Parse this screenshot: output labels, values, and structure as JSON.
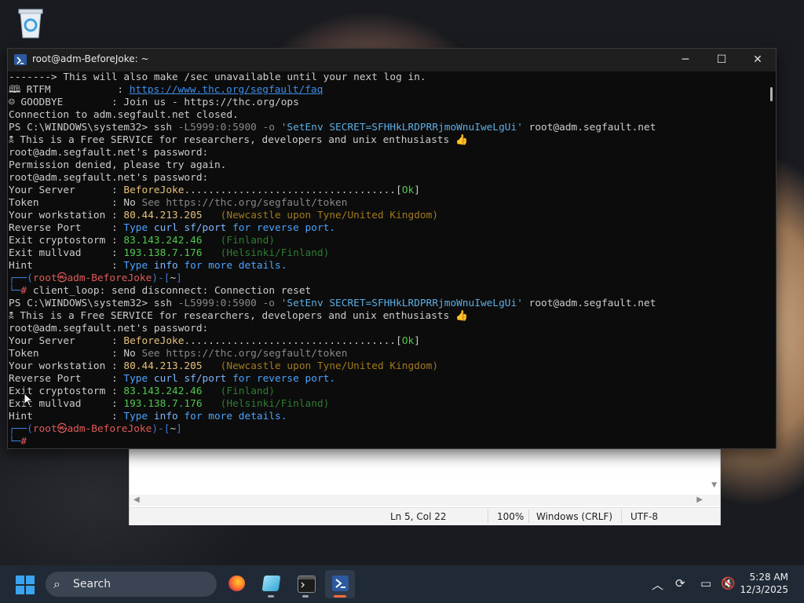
{
  "window": {
    "title": "root@adm-BeforeJoke: ~",
    "minimize": "─",
    "maximize": "☐",
    "close": "✕"
  },
  "terminal": {
    "lines": [
      [
        {
          "t": "-------> This will also make /sec unavailable until your next log in.",
          "c": "c-w"
        }
      ],
      [
        {
          "t": "🕮 RTFM           : ",
          "c": "c-w"
        },
        {
          "t": "https://www.thc.org/segfault/faq",
          "c": "c-url"
        }
      ],
      [
        {
          "t": "☺ GOODBYE        : Join us - https://thc.org/ops",
          "c": "c-w"
        }
      ],
      [
        {
          "t": "Connection to adm.segfault.net closed.",
          "c": "c-w"
        }
      ],
      [
        {
          "t": "PS C:\\WINDOWS\\system32> ssh ",
          "c": "c-w"
        },
        {
          "t": "-L5999:0:5900 -o ",
          "c": "c-gr"
        },
        {
          "t": "'SetEnv SECRET=SFHHkLRDPRRjmoWnuIweLgUi'",
          "c": "c-str"
        },
        {
          "t": " root@adm.segfault.net",
          "c": "c-w"
        }
      ],
      [
        {
          "t": "🕱 This is a Free SERVICE for researchers, developers and unix enthusiasts 👍",
          "c": "c-w"
        }
      ],
      [
        {
          "t": "root@adm.segfault.net's password:",
          "c": "c-w"
        }
      ],
      [
        {
          "t": "Permission denied, please try again.",
          "c": "c-w"
        }
      ],
      [
        {
          "t": "root@adm.segfault.net's password:",
          "c": "c-w"
        }
      ],
      [
        {
          "t": "Your Server      : ",
          "c": "c-w"
        },
        {
          "t": "BeforeJoke",
          "c": "c-y"
        },
        {
          "t": "...................................",
          "c": "c-w"
        },
        {
          "t": "[",
          "c": "c-w"
        },
        {
          "t": "Ok",
          "c": "c-g"
        },
        {
          "t": "]",
          "c": "c-w"
        }
      ],
      [
        {
          "t": "Token            : No ",
          "c": "c-w"
        },
        {
          "t": "See https://thc.org/segfault/token",
          "c": "c-gr"
        }
      ],
      [
        {
          "t": "Your workstation : ",
          "c": "c-w"
        },
        {
          "t": "80.44.213.205   ",
          "c": "c-y"
        },
        {
          "t": "(Newcastle upon Tyne/United Kingdom)",
          "c": "c-dy"
        }
      ],
      [
        {
          "t": "Reverse Port     : ",
          "c": "c-w"
        },
        {
          "t": "Type ",
          "c": "c-b"
        },
        {
          "t": "curl sf/port",
          "c": "c-bl"
        },
        {
          "t": " for reverse port.",
          "c": "c-b"
        }
      ],
      [
        {
          "t": "Exit cryptostorm : ",
          "c": "c-w"
        },
        {
          "t": "83.143.242.46   ",
          "c": "c-g"
        },
        {
          "t": "(Finland)",
          "c": "c-dg"
        }
      ],
      [
        {
          "t": "Exit mullvad     : ",
          "c": "c-w"
        },
        {
          "t": "193.138.7.176   ",
          "c": "c-g"
        },
        {
          "t": "(Helsinki/Finland)",
          "c": "c-dg"
        }
      ],
      [
        {
          "t": "Hint             : ",
          "c": "c-w"
        },
        {
          "t": "Type ",
          "c": "c-b"
        },
        {
          "t": "info",
          "c": "c-bl"
        },
        {
          "t": " for more details.",
          "c": "c-b"
        }
      ],
      [
        {
          "t": "┌──(",
          "c": "c-blue"
        },
        {
          "t": "root㉿adm-BeforeJoke",
          "c": "c-red"
        },
        {
          "t": ")-[",
          "c": "c-blue"
        },
        {
          "t": "~",
          "c": "c-w"
        },
        {
          "t": "]",
          "c": "c-blue"
        }
      ],
      [
        {
          "t": "└─",
          "c": "c-blue"
        },
        {
          "t": "# ",
          "c": "c-red"
        },
        {
          "t": "client_loop: send disconnect: Connection reset",
          "c": "c-w"
        }
      ],
      [
        {
          "t": "PS C:\\WINDOWS\\system32> ssh ",
          "c": "c-w"
        },
        {
          "t": "-L5999:0:5900 -o ",
          "c": "c-gr"
        },
        {
          "t": "'SetEnv SECRET=SFHHkLRDPRRjmoWnuIweLgUi'",
          "c": "c-str"
        },
        {
          "t": " root@adm.segfault.net",
          "c": "c-w"
        }
      ],
      [
        {
          "t": "🕱 This is a Free SERVICE for researchers, developers and unix enthusiasts 👍",
          "c": "c-w"
        }
      ],
      [
        {
          "t": "root@adm.segfault.net's password:",
          "c": "c-w"
        }
      ],
      [
        {
          "t": "Your Server      : ",
          "c": "c-w"
        },
        {
          "t": "BeforeJoke",
          "c": "c-y"
        },
        {
          "t": "...................................",
          "c": "c-w"
        },
        {
          "t": "[",
          "c": "c-w"
        },
        {
          "t": "Ok",
          "c": "c-g"
        },
        {
          "t": "]",
          "c": "c-w"
        }
      ],
      [
        {
          "t": "Token            : No ",
          "c": "c-w"
        },
        {
          "t": "See https://thc.org/segfault/token",
          "c": "c-gr"
        }
      ],
      [
        {
          "t": "Your workstation : ",
          "c": "c-w"
        },
        {
          "t": "80.44.213.205   ",
          "c": "c-y"
        },
        {
          "t": "(Newcastle upon Tyne/United Kingdom)",
          "c": "c-dy"
        }
      ],
      [
        {
          "t": "Reverse Port     : ",
          "c": "c-w"
        },
        {
          "t": "Type ",
          "c": "c-b"
        },
        {
          "t": "curl sf/port",
          "c": "c-bl"
        },
        {
          "t": " for reverse port.",
          "c": "c-b"
        }
      ],
      [
        {
          "t": "Exit cryptostorm : ",
          "c": "c-w"
        },
        {
          "t": "83.143.242.46   ",
          "c": "c-g"
        },
        {
          "t": "(Finland)",
          "c": "c-dg"
        }
      ],
      [
        {
          "t": "Exit mullvad     : ",
          "c": "c-w"
        },
        {
          "t": "193.138.7.176   ",
          "c": "c-g"
        },
        {
          "t": "(Helsinki/Finland)",
          "c": "c-dg"
        }
      ],
      [
        {
          "t": "Hint             : ",
          "c": "c-w"
        },
        {
          "t": "Type ",
          "c": "c-b"
        },
        {
          "t": "info",
          "c": "c-bl"
        },
        {
          "t": " for more details.",
          "c": "c-b"
        }
      ],
      [
        {
          "t": "┌──(",
          "c": "c-blue"
        },
        {
          "t": "root㉿adm-BeforeJoke",
          "c": "c-red"
        },
        {
          "t": ")-[",
          "c": "c-blue"
        },
        {
          "t": "~",
          "c": "c-w"
        },
        {
          "t": "]",
          "c": "c-blue"
        }
      ],
      [
        {
          "t": "└─",
          "c": "c-blue"
        },
        {
          "t": "#",
          "c": "c-red"
        }
      ]
    ]
  },
  "notepad": {
    "status": {
      "position": "Ln 5, Col 22",
      "zoom": "100%",
      "line_ending": "Windows (CRLF)",
      "encoding": "UTF-8"
    }
  },
  "taskbar": {
    "search_label": "Search",
    "apps": [
      "firefox-icon",
      "notepad-icon",
      "terminal-icon",
      "powershell-icon"
    ],
    "clock_time": "5:28 AM",
    "clock_date": "12/3/2025"
  },
  "colors": {
    "terminal_bg": "#0c0c0c",
    "taskbar_bg": "#202a36",
    "accent": "#ff6b3d"
  }
}
